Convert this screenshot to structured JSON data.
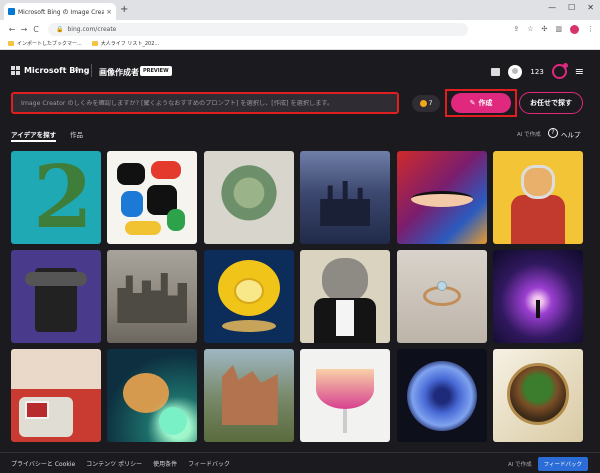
{
  "browser": {
    "tab_title": "Microsoft Bing の Image Creator",
    "tab_close": "×",
    "new_tab": "+",
    "window_controls": [
      "—",
      "☐",
      "✕"
    ],
    "nav": [
      "←",
      "→",
      "C"
    ],
    "url": "bing.com/create",
    "bookmarks": [
      "インポートしたブックマー...",
      "大人ライフ リスト_202..."
    ]
  },
  "header": {
    "brand": "Microsoft Bing",
    "page_title": "画像作成者",
    "badge": "PREVIEW",
    "points": "123"
  },
  "prompt": {
    "placeholder": "Image Creator のしくみを確認しますか? [驚くようなおすすめのプロンプト] を選択し、[作成] を選択します。",
    "boosts": "7",
    "create_label": "作成",
    "surprise_label": "お任せで探す"
  },
  "tabs": {
    "ideas": "アイデアを探す",
    "creations": "作品",
    "ai_info": "AI で作成",
    "help_icon": "?",
    "help": "ヘルプ"
  },
  "gallery": {
    "tile1_text": "2"
  },
  "footer": {
    "links": [
      "プライバシーと Cookie",
      "コンテンツ ポリシー",
      "使用条件",
      "フィードバック"
    ],
    "ai_label": "AI で作成",
    "feedback_button": "フィードバック"
  }
}
